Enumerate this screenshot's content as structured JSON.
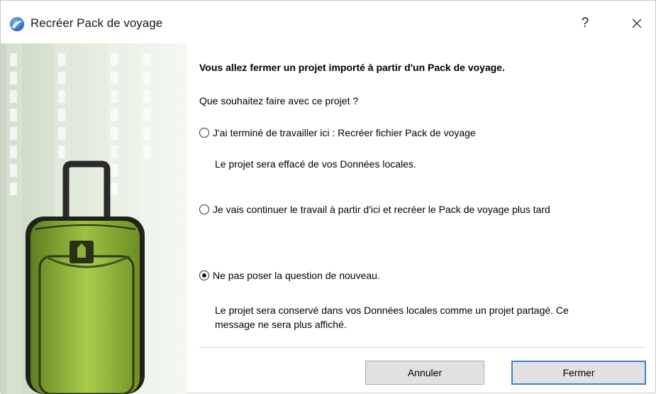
{
  "window": {
    "title": "Recréer Pack de voyage",
    "help_label": "?",
    "app_icon": "archicad-logo-icon",
    "close_icon": "close-icon"
  },
  "content": {
    "heading": "Vous allez fermer un projet importé à partir d'un Pack de voyage.",
    "question": "Que souhaitez faire avec ce projet ?"
  },
  "options": [
    {
      "label": "J'ai terminé de travailler ici : Recréer fichier Pack de voyage",
      "description": "Le projet sera effacé de vos Données locales.",
      "selected": false
    },
    {
      "label": "Je vais continuer le travail à partir d'ici et recréer le Pack de voyage plus tard",
      "description": "",
      "selected": false
    },
    {
      "label": "Ne pas poser la question de nouveau.",
      "description_line1": "Le projet sera conservé dans vos Données locales comme un projet partagé. Ce",
      "description_line2": "message ne sera plus affiché.",
      "selected": true
    }
  ],
  "buttons": {
    "cancel": "Annuler",
    "close": "Fermer"
  },
  "colors": {
    "accent": "#3c7fd6",
    "suitcase_green": "#8cb23a"
  }
}
